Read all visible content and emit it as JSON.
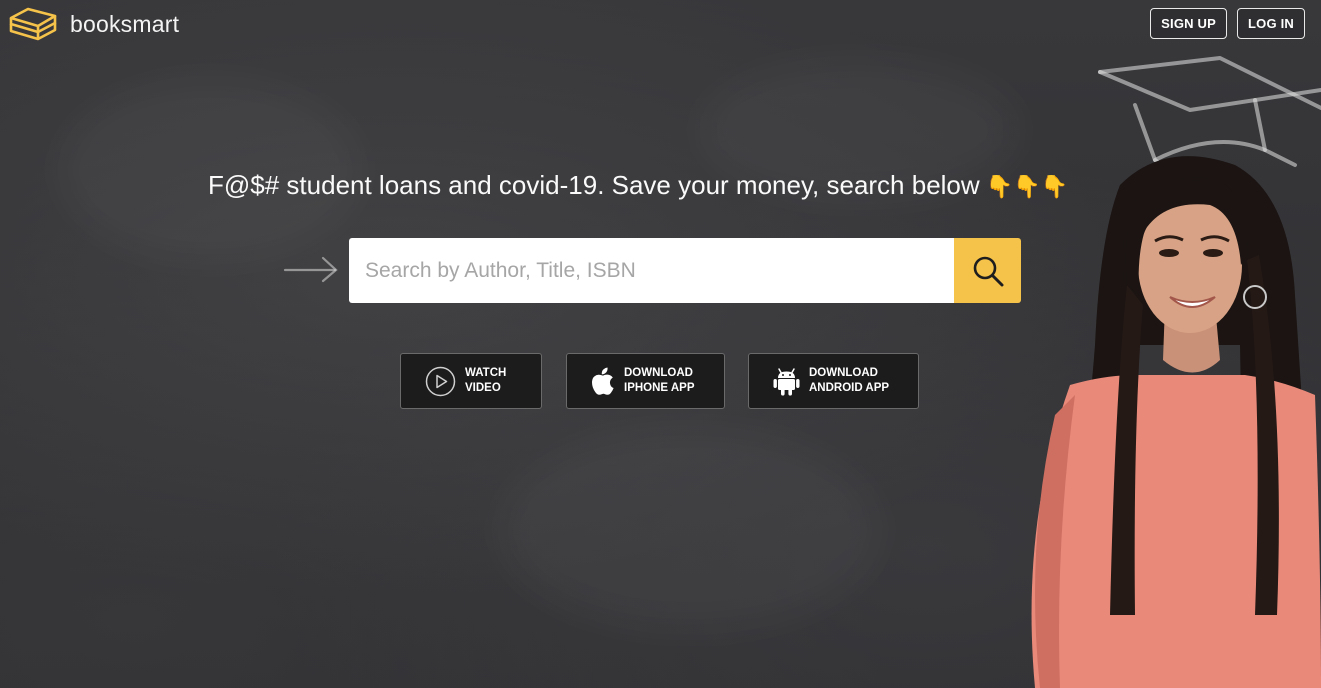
{
  "brand": {
    "name": "booksmart",
    "accent": "#f6c34a"
  },
  "header": {
    "sign_up_label": "SIGN UP",
    "log_in_label": "LOG IN"
  },
  "hero": {
    "headline": "F@$# student loans and covid-19. Save your money, search below",
    "emoji": "👇👇👇"
  },
  "search": {
    "placeholder": "Search by Author, Title, ISBN",
    "value": "",
    "button_icon": "search-icon"
  },
  "actions": {
    "video": {
      "line1": "WATCH",
      "line2": "VIDEO",
      "icon": "play-icon"
    },
    "iphone": {
      "line1": "DOWNLOAD",
      "line2": "IPHONE APP",
      "icon": "apple-icon"
    },
    "android": {
      "line1": "DOWNLOAD",
      "line2": "ANDROID APP",
      "icon": "android-icon"
    }
  }
}
